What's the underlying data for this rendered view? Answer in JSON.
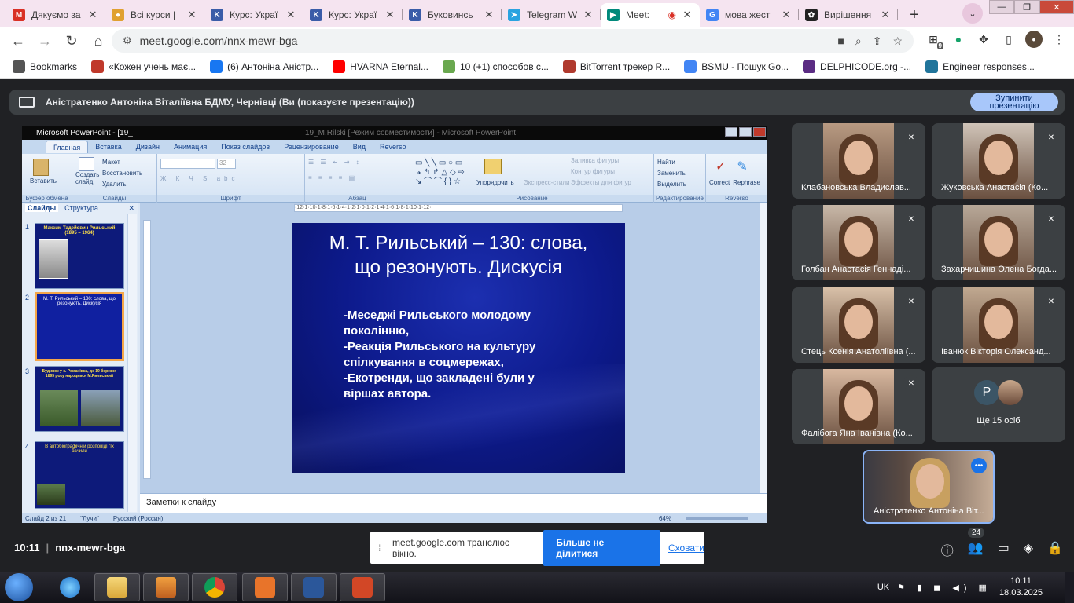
{
  "browser": {
    "tabs": [
      {
        "title": "Дякуємо за",
        "icon": "gmail-icon",
        "color": "#d93025",
        "letter": "M"
      },
      {
        "title": "Всі курси |",
        "icon": "course-icon",
        "color": "#e0a030",
        "letter": "●"
      },
      {
        "title": "Курс: Украї",
        "icon": "moodle-icon",
        "color": "#3a5ca8",
        "letter": "K"
      },
      {
        "title": "Курс: Украї",
        "icon": "moodle-icon",
        "color": "#3a5ca8",
        "letter": "K"
      },
      {
        "title": "Буковинсь",
        "icon": "moodle-icon",
        "color": "#3a5ca8",
        "letter": "K"
      },
      {
        "title": "Telegram W",
        "icon": "telegram-icon",
        "color": "#2aa3e0",
        "letter": "➤"
      },
      {
        "title": "Meet: ",
        "icon": "meet-icon",
        "color": "#00897b",
        "letter": "▶"
      },
      {
        "title": "мова жест",
        "icon": "google-icon",
        "color": "#4285f4",
        "letter": "G"
      },
      {
        "title": "Вирішення",
        "icon": "openai-icon",
        "color": "#222222",
        "letter": "✿"
      }
    ],
    "url": "meet.google.com/nnx-mewr-bga",
    "extension_badge": "9",
    "bookmarks": [
      {
        "label": "Bookmarks",
        "icon": "star-icon",
        "color": "#555555"
      },
      {
        "label": "«Кожен учень має...",
        "icon": "site-icon",
        "color": "#c0392b"
      },
      {
        "label": "(6) Антоніна Аністр...",
        "icon": "facebook-icon",
        "color": "#1877f2"
      },
      {
        "label": "HVARNA Eternal...",
        "icon": "youtube-icon",
        "color": "#ff0000"
      },
      {
        "label": "10 (+1) способов с...",
        "icon": "site-icon",
        "color": "#6aa84f"
      },
      {
        "label": "BitTorrent трекер R...",
        "icon": "torrent-icon",
        "color": "#b03a2e"
      },
      {
        "label": "BSMU - Пошук Go...",
        "icon": "google-icon",
        "color": "#4285f4"
      },
      {
        "label": "DELPHICODE.org -...",
        "icon": "site-icon",
        "color": "#5b2c83"
      },
      {
        "label": "Engineer responses...",
        "icon": "wordpress-icon",
        "color": "#21759b"
      }
    ]
  },
  "meet": {
    "presenting_text": "Аністратенко Антоніна Віталіївна БДМУ, Чернівці (Ви (показуєте презентацію))",
    "stop_button": "Зупинити презентацію",
    "participants": [
      {
        "name": "Клабановська Владислав..."
      },
      {
        "name": "Жуковська Анастасія (Ко..."
      },
      {
        "name": "Голбан Анастасія Геннаді..."
      },
      {
        "name": "Захарчишина Олена Богда..."
      },
      {
        "name": "Стець Ксенія Анатоліївна (..."
      },
      {
        "name": "Іванюк Вікторія Олександ..."
      },
      {
        "name": "Фалібога Яна Іванівна (Ко..."
      }
    ],
    "more_tile": {
      "initial": "P",
      "label": "Ще 15 осіб"
    },
    "self_tile": {
      "name": "Аністратенко Антоніна Віт..."
    },
    "time": "10:11",
    "meeting_code": "nnx-mewr-bga",
    "people_count": "24",
    "share_bar": {
      "message": "meet.google.com транслює вікно.",
      "stop_label": "Більше не ділитися",
      "hide_label": "Сховати"
    }
  },
  "powerpoint": {
    "window_title_left": "Microsoft PowerPoint - [19_",
    "window_title_center": "19_M.Rilski [Режим совместимости] - Microsoft PowerPoint",
    "ribbon_tabs": [
      "Главная",
      "Вставка",
      "Дизайн",
      "Анимация",
      "Показ слайдов",
      "Рецензирование",
      "Вид",
      "Reverso"
    ],
    "groups": {
      "clipboard": {
        "label": "Буфер обмена",
        "paste": "Вставить"
      },
      "slides": {
        "label": "Слайды",
        "new_slide": "Создать слайд",
        "layout": "Макет",
        "reset": "Восстановить",
        "delete": "Удалить"
      },
      "font": {
        "label": "Шрифт",
        "size": "32"
      },
      "paragraph": {
        "label": "Абзац"
      },
      "drawing": {
        "label": "Рисование",
        "arrange": "Упорядочить",
        "styles": "Экспресс-стили",
        "fill": "Заливка фигуры",
        "outline": "Контур фигуры",
        "effects": "Эффекты для фигур"
      },
      "editing": {
        "label": "Редактирование",
        "find": "Найти",
        "replace": "Заменить",
        "select": "Выделить"
      },
      "reverso": {
        "label": "Reverso",
        "correct": "Correct",
        "rephrase": "Rephrase"
      }
    },
    "pane_tabs": [
      "Слайды",
      "Структура"
    ],
    "thumbnails": [
      {
        "num": "1",
        "text": "Максим Тадейович Рильський (1895 – 1964)"
      },
      {
        "num": "2",
        "text": "М. Т. Рильський – 130: слова, що резонують. Дискусія"
      },
      {
        "num": "3",
        "text": "Будинок у с. Романівка, де 19 березня 1895 року народився М.Рильський"
      },
      {
        "num": "4",
        "text": "В автобіографічній розповіді \"Іх бачили"
      }
    ],
    "ruler": "·12·1·10·1·8·1·6·1·4·1·2·1·0·1·2·1·4·1·6·1·8·1·10·1·12·",
    "slide": {
      "title_line1": "М. Т. Рильський – 130: слова,",
      "title_line2": "що резонують. Дискусія",
      "bullets": [
        "-Меседжі Рильського молодому",
        "поколінню,",
        "-Реакція Рильського на культуру",
        "спілкування в соцмережах,",
        "-Екотренди, що закладені були у",
        "віршах автора."
      ]
    },
    "notes_placeholder": "Заметки к слайду",
    "status": {
      "slide": "Слайд 2 из 21",
      "theme": "\"Лучи\"",
      "language": "Русский (Россия)",
      "zoom": "64%"
    }
  },
  "taskbar": {
    "lang": "UK",
    "time": "10:11",
    "date": "18.03.2025"
  }
}
